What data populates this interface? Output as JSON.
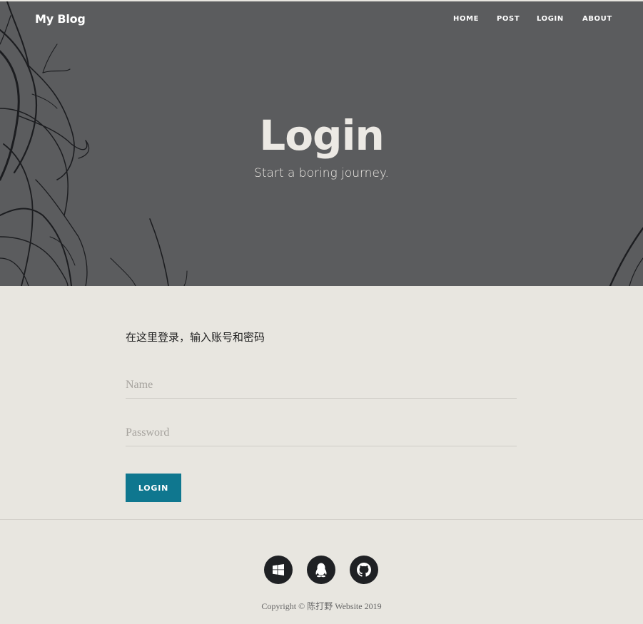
{
  "site": {
    "brand": "My Blog"
  },
  "nav": {
    "items": [
      {
        "label": "HOME"
      },
      {
        "label": "POST"
      },
      {
        "label": "LOGIN"
      },
      {
        "label": "ABOUT"
      }
    ]
  },
  "hero": {
    "title": "Login",
    "subtitle": "Start a boring journey."
  },
  "form": {
    "intro": "在这里登录，输入账号和密码",
    "name_placeholder": "Name",
    "name_value": "",
    "password_placeholder": "Password",
    "password_value": "",
    "login_label": "LOGIN",
    "login_button_color": "#0f778f"
  },
  "footer": {
    "social": [
      {
        "icon": "windows-icon"
      },
      {
        "icon": "qq-icon"
      },
      {
        "icon": "github-icon"
      }
    ],
    "copyright": "Copyright © 陈打野 Website 2019"
  },
  "colors": {
    "header_bg": "#5b5c5e",
    "page_bg": "#e8e6e0",
    "social_bg": "#1f2124"
  }
}
